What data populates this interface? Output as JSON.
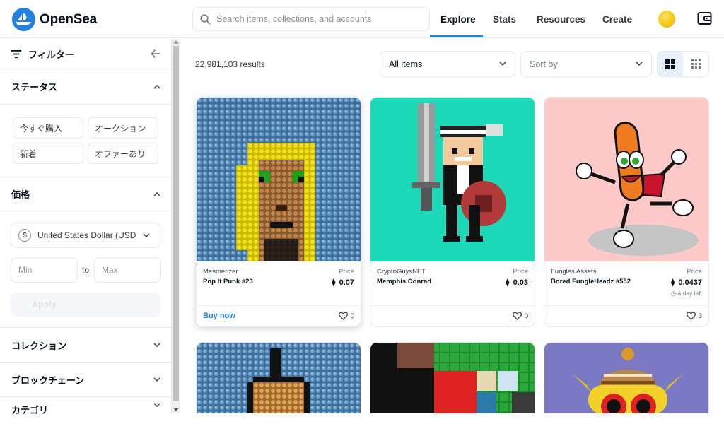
{
  "header": {
    "brand": "OpenSea",
    "search_placeholder": "Search items, collections, and accounts",
    "nav": [
      "Explore",
      "Stats",
      "Resources",
      "Create"
    ]
  },
  "sidebar": {
    "filter_title": "フィルター",
    "status": {
      "title": "ステータス",
      "chips": [
        "今すぐ購入",
        "オークション",
        "新着",
        "オファーあり"
      ]
    },
    "price": {
      "title": "価格",
      "currency": "United States Dollar (USD)",
      "currency_symbol": "$",
      "min_placeholder": "Min",
      "max_placeholder": "Max",
      "to": "to",
      "apply": "Apply"
    },
    "sections": [
      "コレクション",
      "ブロックチェーン",
      "カテゴリ"
    ]
  },
  "main": {
    "results": "22,981,103 results",
    "items_filter": "All items",
    "sort": "Sort by"
  },
  "cards": [
    {
      "collection": "Mesmerizer",
      "name": "Pop It Punk #23",
      "price_label": "Price",
      "price": "0.07",
      "likes": "0",
      "buy": "Buy now",
      "time": ""
    },
    {
      "collection": "CryptoGuysNFT",
      "name": "Memphis Conrad",
      "price_label": "Price",
      "price": "0.03",
      "likes": "0",
      "buy": "",
      "time": ""
    },
    {
      "collection": "Fungles Assets",
      "name": "Bored FungleHeadz #552",
      "price_label": "Price",
      "price": "0.0437",
      "likes": "3",
      "buy": "",
      "time": "a day left"
    }
  ],
  "colors": {
    "accent": "#2081e2",
    "text": "#04111d",
    "border": "#e5e8eb"
  }
}
